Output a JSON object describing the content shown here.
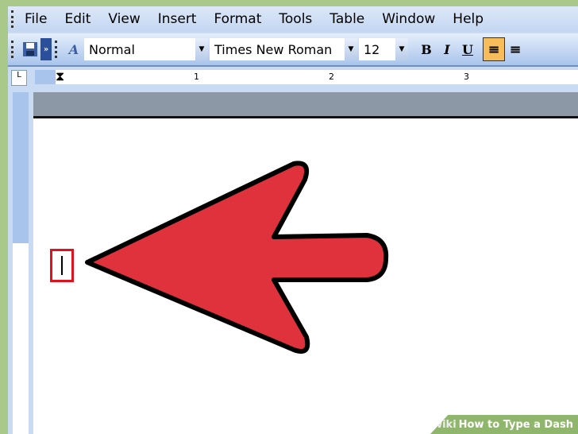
{
  "menu": [
    "File",
    "Edit",
    "View",
    "Insert",
    "Format",
    "Tools",
    "Table",
    "Window",
    "Help"
  ],
  "toolbar": {
    "style": "Normal",
    "font": "Times New Roman",
    "size": "12",
    "bold": "B",
    "italic": "I",
    "underline": "U"
  },
  "ruler": {
    "numbers": [
      "1",
      "2",
      "3"
    ],
    "tab_selector": "L"
  },
  "arrow_color": "#e0323c",
  "watermark": {
    "wiki": "wiki",
    "title": "How to Type a Dash"
  }
}
